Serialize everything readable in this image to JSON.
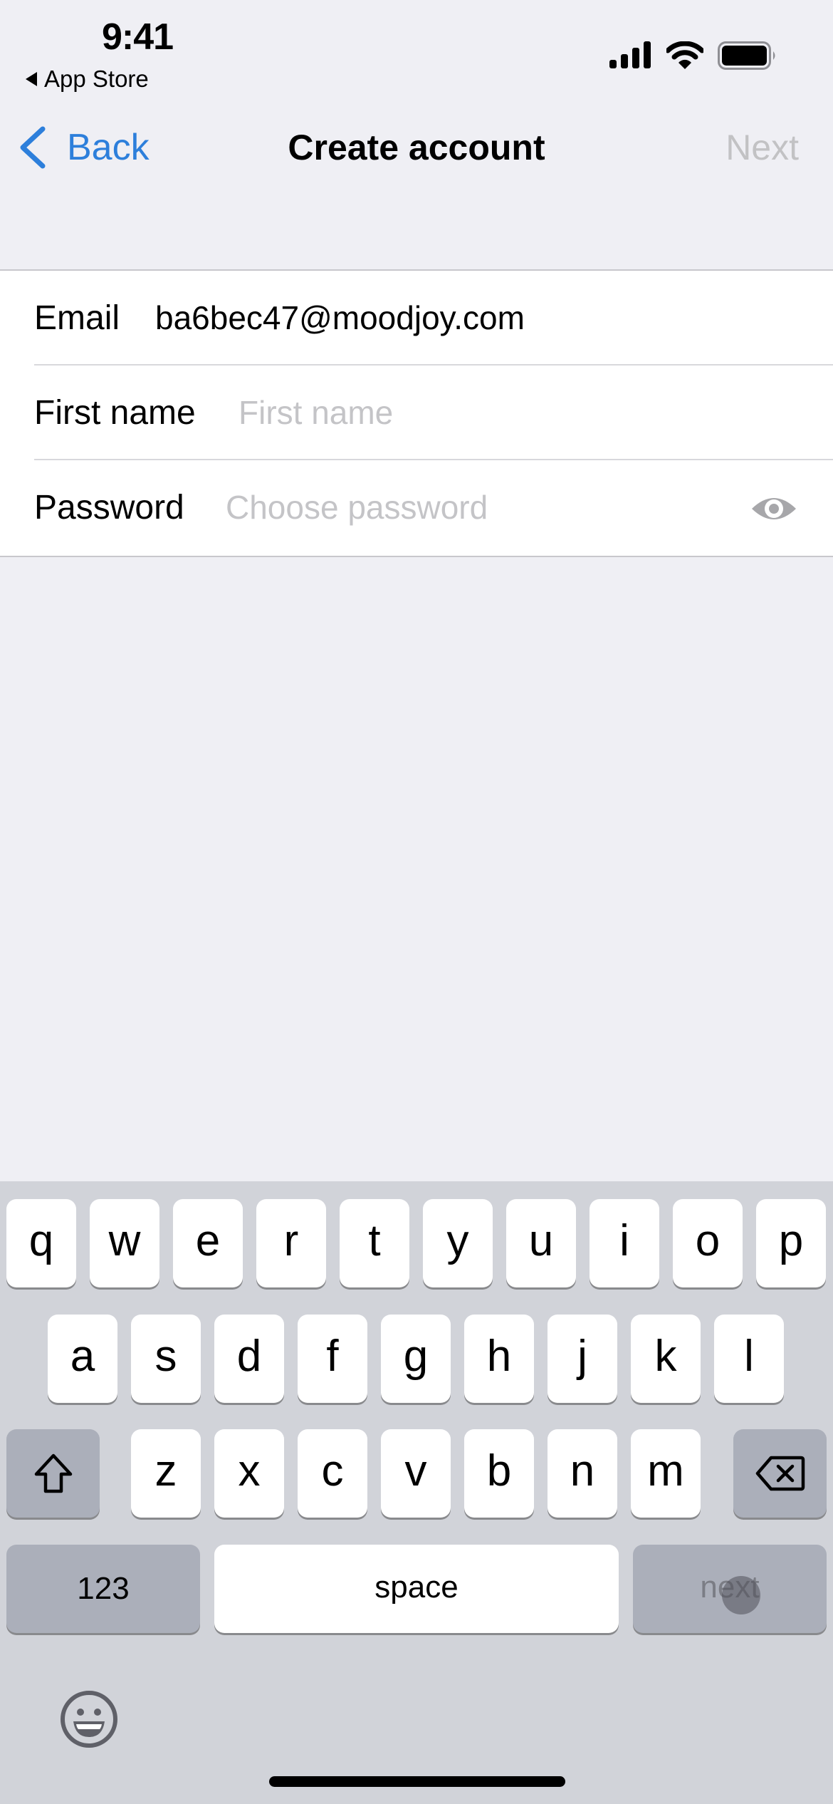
{
  "status_bar": {
    "time": "9:41",
    "back_app": "App Store",
    "icons": [
      "cellular-signal-icon",
      "wifi-icon",
      "battery-icon"
    ]
  },
  "nav": {
    "back_label": "Back",
    "title": "Create account",
    "next_label": "Next",
    "accent_color": "#2D7FDB",
    "disabled_color": "#C2C2C4"
  },
  "form": {
    "fields": [
      {
        "label": "Email",
        "value": "ba6bec47@moodjoy.com",
        "placeholder": ""
      },
      {
        "label": "First name",
        "value": "",
        "placeholder": "First name"
      },
      {
        "label": "Password",
        "value": "",
        "placeholder": "Choose password",
        "icon": "eye-icon"
      }
    ]
  },
  "keyboard": {
    "row1": [
      "q",
      "w",
      "e",
      "r",
      "t",
      "y",
      "u",
      "i",
      "o",
      "p"
    ],
    "row2": [
      "a",
      "s",
      "d",
      "f",
      "g",
      "h",
      "j",
      "k",
      "l"
    ],
    "row3": [
      "z",
      "x",
      "c",
      "v",
      "b",
      "n",
      "m"
    ],
    "shift_icon": "shift-icon",
    "delete_icon": "delete-backward-icon",
    "numbers_label": "123",
    "space_label": "space",
    "return_label": "next",
    "emoji_icon": "emoji-icon"
  }
}
